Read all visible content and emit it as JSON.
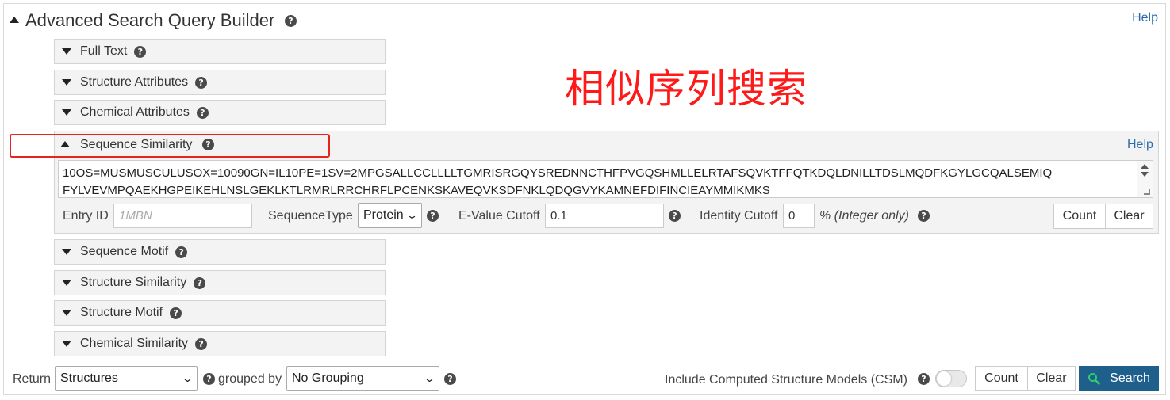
{
  "header": {
    "title": "Advanced Search Query Builder",
    "help": "Help"
  },
  "annotation": "相似序列搜索",
  "sections": {
    "full_text": "Full Text",
    "structure_attributes": "Structure Attributes",
    "chemical_attributes": "Chemical Attributes",
    "sequence_similarity": "Sequence Similarity",
    "sequence_motif": "Sequence Motif",
    "structure_similarity": "Structure Similarity",
    "structure_motif": "Structure Motif",
    "chemical_similarity": "Chemical Similarity"
  },
  "sequence": {
    "help": "Help",
    "text_line1": "10OS=MUSMUSCULUSOX=10090GN=IL10PE=1SV=2MPGSALLCCLLLLTGMRISRGQYSREDNNCTHFPVGQSHMLLELRTAFSQVKTFFQTKDQLDNILLTDSLMQDFKGYLGCQALSEMIQ",
    "text_line2": "FYLVEVMPQAEKHGPEIKEHLNSLGEKLKTLRMRLRRCHRFLPCENKSKAVEQVKSDFNKLQDQGVYKAMNEFDIFINCIEAYMMIKMKS",
    "entry_id_label": "Entry ID",
    "entry_id_placeholder": "1MBN",
    "sequence_type_label": "SequenceType",
    "sequence_type_value": "Protein",
    "evalue_label": "E-Value Cutoff",
    "evalue_value": "0.1",
    "identity_label": "Identity Cutoff",
    "identity_value": "0",
    "identity_unit": "% (Integer only)",
    "count": "Count",
    "clear": "Clear"
  },
  "footer": {
    "return_label": "Return",
    "return_value": "Structures",
    "grouped_by_label": "grouped by",
    "grouping_value": "No Grouping",
    "csm_label": "Include Computed Structure Models (CSM)",
    "count": "Count",
    "clear": "Clear",
    "search": "Search"
  },
  "colors": {
    "annotation": "#ff1a1a",
    "highlight_box": "#e8231f",
    "search_button": "#1f5f8b",
    "help_link": "#2b6cb0"
  }
}
